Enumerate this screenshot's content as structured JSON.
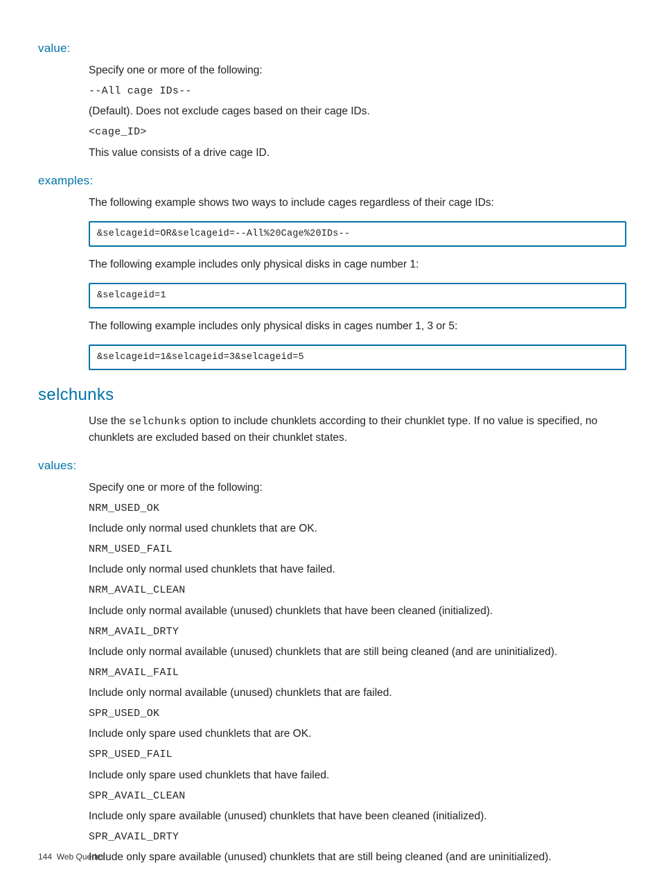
{
  "sections": {
    "value": {
      "heading": "value:",
      "intro": "Specify one or more of the following:",
      "opt1_code": "--All cage IDs--",
      "opt1_desc": "(Default). Does not exclude cages based on their cage IDs.",
      "opt2_code": "<cage_ID>",
      "opt2_desc": "This value consists of a drive cage ID."
    },
    "examples": {
      "heading": "examples:",
      "ex1_text": "The following example shows two ways to include cages regardless of their cage IDs:",
      "ex1_code": "&selcageid=OR&selcageid=--All%20Cage%20IDs--",
      "ex2_text": "The following example includes only physical disks in cage number 1:",
      "ex2_code": "&selcageid=1",
      "ex3_text": "The following example includes only physical disks in cages number 1, 3 or 5:",
      "ex3_code": "&selcageid=1&selcageid=3&selcageid=5"
    },
    "selchunks": {
      "heading": "selchunks",
      "para_pre": "Use the ",
      "para_code": "selchunks",
      "para_post": " option to include chunklets according to their chunklet type. If no value is specified, no chunklets are excluded based on their chunklet states."
    },
    "values": {
      "heading": "values:",
      "intro": "Specify one or more of the following:",
      "items": [
        {
          "code": "NRM_USED_OK",
          "desc": "Include only normal used chunklets that are OK."
        },
        {
          "code": "NRM_USED_FAIL",
          "desc": "Include only normal used chunklets that have failed."
        },
        {
          "code": "NRM_AVAIL_CLEAN",
          "desc": "Include only normal available (unused) chunklets that have been cleaned (initialized)."
        },
        {
          "code": "NRM_AVAIL_DRTY",
          "desc": "Include only normal available (unused) chunklets that are still being cleaned (and are uninitialized)."
        },
        {
          "code": "NRM_AVAIL_FAIL",
          "desc": "Include only normal available (unused) chunklets that are failed."
        },
        {
          "code": "SPR_USED_OK",
          "desc": "Include only spare used chunklets that are OK."
        },
        {
          "code": "SPR_USED_FAIL",
          "desc": "Include only spare used chunklets that have failed."
        },
        {
          "code": "SPR_AVAIL_CLEAN",
          "desc": "Include only spare available (unused) chunklets that have been cleaned (initialized)."
        },
        {
          "code": "SPR_AVAIL_DRTY",
          "desc": "Include only spare available (unused) chunklets that are still being cleaned (and are uninitialized)."
        }
      ]
    }
  },
  "footer": {
    "page": "144",
    "title": "Web Queries"
  }
}
